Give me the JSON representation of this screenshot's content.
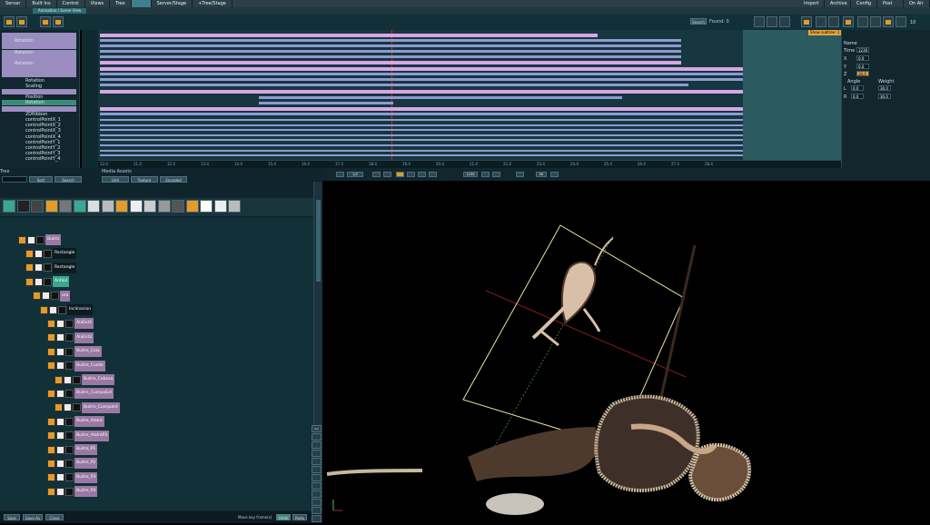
{
  "menubar": {
    "tabs": [
      "Server",
      "Built Ins",
      "Control",
      "Views",
      "Tree",
      "",
      "Server/Stage",
      "+Tree/Stage"
    ],
    "active_index": 5,
    "right_tabs": [
      "Import",
      "Archive",
      "Config",
      "Post",
      "On Air"
    ]
  },
  "title": {
    "document": "Animation / Scene View"
  },
  "toolbar": {
    "search_label": "Search",
    "found_label": "Found: 0",
    "tooltip": "Show subtree: 1"
  },
  "timeline_tree": {
    "rows": [
      {
        "label": "",
        "style": "lav"
      },
      {
        "label": "Rotation",
        "style": "lav"
      },
      {
        "label": "",
        "style": "lav"
      },
      {
        "label": "Rotation",
        "style": "lav"
      },
      {
        "label": "",
        "style": "lav"
      },
      {
        "label": "Rotation",
        "style": "lav"
      },
      {
        "label": "",
        "style": "lav"
      },
      {
        "label": "",
        "style": "lav"
      },
      {
        "label": "Rotation",
        "style": "plain"
      },
      {
        "label": "Scaling",
        "style": "plain"
      },
      {
        "label": "",
        "style": "lav"
      },
      {
        "label": "Position",
        "style": "plain"
      },
      {
        "label": "Rotation",
        "style": "sel"
      },
      {
        "label": "",
        "style": "lav"
      },
      {
        "label": "2DRibbon",
        "style": "plain"
      },
      {
        "label": "controlPointX_1",
        "style": "plain"
      },
      {
        "label": "controlPointX_2",
        "style": "plain"
      },
      {
        "label": "controlPointX_3",
        "style": "plain"
      },
      {
        "label": "controlPointX_4",
        "style": "plain"
      },
      {
        "label": "controlPointY_1",
        "style": "plain"
      },
      {
        "label": "controlPointY_2",
        "style": "plain"
      },
      {
        "label": "controlPointY_3",
        "style": "plain"
      },
      {
        "label": "controlPointY_4",
        "style": "plain"
      }
    ]
  },
  "ruler": {
    "labels": [
      "12.0",
      "11.4",
      "12.4",
      "13.4",
      "14.4",
      "15.4",
      "16.4",
      "17.4",
      "18.4",
      "19.4",
      "20.4",
      "21.4",
      "22.4",
      "23.4",
      "24.4",
      "25.4",
      "26.4",
      "27.4",
      "28.4"
    ]
  },
  "props": {
    "name_label": "Name",
    "time_label": "Time",
    "time_value": "1230",
    "x_label": "X",
    "x_value": "0.0",
    "y_label": "Y",
    "y_value": "0.0",
    "z_label": "Z",
    "z_value": "30.0",
    "angle_label": "Angle",
    "weight_label": "Weight",
    "l_label": "L",
    "l_angle": "0.0",
    "l_weight": "30.0",
    "r_label": "R",
    "r_angle": "0.0",
    "r_weight": "30.0",
    "top_value": "10"
  },
  "playbar": {
    "frame_left": "1/2",
    "frame_mid": "1230",
    "frame_right": "50"
  },
  "left_panel": {
    "tree_label": "Tree",
    "sort_label": "Sort",
    "search_label": "Search",
    "media_assets_label": "Media Assets",
    "media_tabs": [
      "Unit",
      "Texture",
      "Encoded"
    ]
  },
  "scene_nodes": [
    {
      "label": "Builra",
      "style": "pur",
      "indent": 0
    },
    {
      "label": "Rectangle",
      "style": "dk",
      "indent": 1
    },
    {
      "label": "Rectangle",
      "style": "dk",
      "indent": 1
    },
    {
      "label": "Antilol",
      "style": "grn",
      "indent": 1
    },
    {
      "label": "ora",
      "style": "pur",
      "indent": 2
    },
    {
      "label": "Inclinacion",
      "style": "dk",
      "indent": 3
    },
    {
      "label": "AlaExt1",
      "style": "pur",
      "indent": 4
    },
    {
      "label": "AlaExt2",
      "style": "pur",
      "indent": 4
    },
    {
      "label": "Buitre_Cola",
      "style": "pur",
      "indent": 4
    },
    {
      "label": "Buitre_Cuello",
      "style": "pur",
      "indent": 4
    },
    {
      "label": "Buitre_Cabeza",
      "style": "pur",
      "indent": 5
    },
    {
      "label": "Buitre_CuerpoExt",
      "style": "pur",
      "indent": 4
    },
    {
      "label": "Buitre_CuerpoInt",
      "style": "pur",
      "indent": 5
    },
    {
      "label": "Buitre_AlaInt",
      "style": "pur",
      "indent": 4
    },
    {
      "label": "Buitre_AlaIntP3",
      "style": "pur",
      "indent": 4
    },
    {
      "label": "Buitre_P1",
      "style": "pur",
      "indent": 4
    },
    {
      "label": "Buitre_P2",
      "style": "pur",
      "indent": 4
    },
    {
      "label": "Buitre_P3",
      "style": "pur",
      "indent": 4
    },
    {
      "label": "Buitre_P4",
      "style": "pur",
      "indent": 4
    }
  ],
  "statusbar": {
    "save": "Save",
    "save_as": "Save As",
    "close": "Close",
    "move_keys": "Move key frame(s)",
    "undo": "Undo",
    "redo": "Redo"
  },
  "side_buttons": [
    "Grp",
    "",
    "",
    "",
    "",
    "",
    "",
    "",
    "",
    "",
    "",
    ""
  ]
}
